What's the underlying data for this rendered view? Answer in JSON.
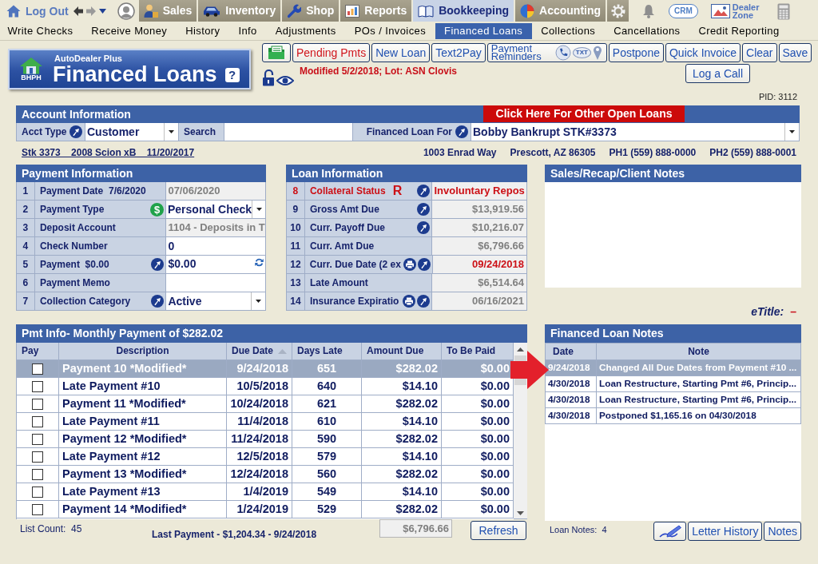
{
  "top_nav": {
    "logout": "Log Out",
    "tabs": [
      {
        "label": "Sales",
        "selected": false
      },
      {
        "label": "Inventory",
        "selected": false
      },
      {
        "label": "Shop",
        "selected": false
      },
      {
        "label": "Reports",
        "selected": false
      },
      {
        "label": "Bookkeeping",
        "selected": true
      },
      {
        "label": "Accounting",
        "selected": false
      }
    ],
    "crm": "CRM",
    "dealer_zone": "Dealer Zone"
  },
  "sub_nav": [
    {
      "label": "Write Checks",
      "selected": false
    },
    {
      "label": "Receive Money",
      "selected": false
    },
    {
      "label": "History",
      "selected": false
    },
    {
      "label": "Info",
      "selected": false
    },
    {
      "label": "Adjustments",
      "selected": false
    },
    {
      "label": "POs / Invoices",
      "selected": false
    },
    {
      "label": "Financed Loans",
      "selected": true
    },
    {
      "label": "Collections",
      "selected": false
    },
    {
      "label": "Cancellations",
      "selected": false
    },
    {
      "label": "Credit Reporting",
      "selected": false
    }
  ],
  "header": {
    "badge": "BHPH",
    "brand": "AutoDealer Plus",
    "title": "Financed Loans",
    "help": "?"
  },
  "toolbar": [
    {
      "kind": "icon"
    },
    {
      "kind": "alert",
      "label": "Pending Pmts"
    },
    {
      "kind": "plain",
      "label": "New Loan"
    },
    {
      "kind": "plain",
      "label": "Text2Pay"
    },
    {
      "kind": "reminders",
      "label": "Payment Reminders",
      "sms": "TXT"
    },
    {
      "kind": "plain",
      "label": "Postpone"
    },
    {
      "kind": "plain",
      "label": "Quick Invoice"
    },
    {
      "kind": "plain",
      "label": "Clear"
    },
    {
      "kind": "plain",
      "label": "Save"
    }
  ],
  "status": {
    "locked": false,
    "text": "Modified 5/2/2018; Lot: ASN Clovis",
    "call_button": "Log a Call",
    "pid": "PID: 3112"
  },
  "account": {
    "title": "Account Information",
    "other_loans": "Click Here For Other Open Loans",
    "acct_type": {
      "label": "Acct Type",
      "value": "Customer"
    },
    "search": {
      "label": "Search"
    },
    "loan_for": {
      "label": "Financed Loan For",
      "value": "Bobby Bankrupt STK#3373"
    }
  },
  "vehicle": {
    "link": "Stk 3373    2008 Scion xB    11/20/2017",
    "contact": [
      "1003 Enrad Way",
      "Prescott, AZ 86305",
      "PH1 (559) 888-0000",
      "PH2 (559) 888-0001"
    ]
  },
  "payment_info": {
    "title": "Payment Information",
    "rows": [
      {
        "num": "1",
        "label": "Payment Date  7/6/2020",
        "lookup": false,
        "kind": "readonly",
        "value": "07/06/2020"
      },
      {
        "num": "2",
        "label": "Payment Type",
        "symbol": "$",
        "lookup": false,
        "kind": "select",
        "value": "Personal Check"
      },
      {
        "num": "3",
        "label": "Deposit Account",
        "lookup": false,
        "kind": "readonly",
        "value": "1104 - Deposits in T"
      },
      {
        "num": "4",
        "label": "Check Number",
        "lookup": false,
        "kind": "input",
        "value": "0"
      },
      {
        "num": "5",
        "label": "Payment  $0.00",
        "lookup": true,
        "kind": "amount",
        "value": "$0.00"
      },
      {
        "num": "6",
        "label": "Payment Memo",
        "lookup": false,
        "kind": "input"
      },
      {
        "num": "7",
        "label": "Collection Category",
        "lookup": true,
        "kind": "select",
        "value": "Active"
      }
    ]
  },
  "loan_info": {
    "title": "Loan Information",
    "rows": [
      {
        "num": "8",
        "label": "Collateral Status",
        "flag": "R",
        "print": false,
        "lookup": true,
        "kind": "text",
        "alert": true,
        "value_alert": true,
        "value": "Involuntary Repos"
      },
      {
        "num": "9",
        "label": "Gross Amt Due",
        "print": false,
        "lookup": true,
        "kind": "amount",
        "alert": false,
        "value_alert": false,
        "value": "$13,919.56"
      },
      {
        "num": "10",
        "label": "Curr. Payoff Due",
        "print": false,
        "lookup": true,
        "kind": "amount",
        "alert": false,
        "value_alert": false,
        "value": "$10,216.07"
      },
      {
        "num": "11",
        "label": "Curr. Amt Due",
        "print": false,
        "lookup": false,
        "kind": "amount",
        "alert": false,
        "value_alert": false,
        "value": "$6,796.66"
      },
      {
        "num": "12",
        "label": "Curr. Due Date (2 ex",
        "print": true,
        "lookup": true,
        "kind": "amount",
        "alert": false,
        "value_alert": true,
        "value": "09/24/2018"
      },
      {
        "num": "13",
        "label": "Late Amount",
        "print": false,
        "lookup": false,
        "kind": "amount",
        "alert": false,
        "value_alert": false,
        "value": "$6,514.64"
      },
      {
        "num": "14",
        "label": "Insurance Expiratio",
        "print": true,
        "lookup": true,
        "kind": "amount",
        "alert": false,
        "value_alert": false,
        "value": "06/16/2021"
      }
    ]
  },
  "sales_notes": {
    "title": "Sales/Recap/Client Notes"
  },
  "etitle": {
    "label": "eTitle:",
    "value": "–"
  },
  "payments": {
    "title": "Pmt Info- Monthly Payment of $282.02",
    "columns": [
      {
        "label": "Pay",
        "sorted": false
      },
      {
        "label": "Description",
        "sorted": false
      },
      {
        "label": "Due Date",
        "sorted": true
      },
      {
        "label": "Days Late",
        "sorted": false
      },
      {
        "label": "Amount Due",
        "sorted": false
      },
      {
        "label": "To Be Paid",
        "sorted": false
      }
    ],
    "rows": [
      {
        "selected": true,
        "checked": false,
        "description": "Payment 10 *Modified*",
        "due_date": "9/24/2018",
        "days_late": "651",
        "amount_due": "$282.02",
        "to_be_paid": "$0.00"
      },
      {
        "selected": false,
        "checked": false,
        "description": "Late Payment #10",
        "due_date": "10/5/2018",
        "days_late": "640",
        "amount_due": "$14.10",
        "to_be_paid": "$0.00"
      },
      {
        "selected": false,
        "checked": false,
        "description": "Payment 11 *Modified*",
        "due_date": "10/24/2018",
        "days_late": "621",
        "amount_due": "$282.02",
        "to_be_paid": "$0.00"
      },
      {
        "selected": false,
        "checked": false,
        "description": "Late Payment #11",
        "due_date": "11/4/2018",
        "days_late": "610",
        "amount_due": "$14.10",
        "to_be_paid": "$0.00"
      },
      {
        "selected": false,
        "checked": false,
        "description": "Payment 12 *Modified*",
        "due_date": "11/24/2018",
        "days_late": "590",
        "amount_due": "$282.02",
        "to_be_paid": "$0.00"
      },
      {
        "selected": false,
        "checked": false,
        "description": "Late Payment #12",
        "due_date": "12/5/2018",
        "days_late": "579",
        "amount_due": "$14.10",
        "to_be_paid": "$0.00"
      },
      {
        "selected": false,
        "checked": false,
        "description": "Payment 13 *Modified*",
        "due_date": "12/24/2018",
        "days_late": "560",
        "amount_due": "$282.02",
        "to_be_paid": "$0.00"
      },
      {
        "selected": false,
        "checked": false,
        "description": "Late Payment #13",
        "due_date": "1/4/2019",
        "days_late": "549",
        "amount_due": "$14.10",
        "to_be_paid": "$0.00"
      },
      {
        "selected": false,
        "checked": false,
        "description": "Payment 14 *Modified*",
        "due_date": "1/24/2019",
        "days_late": "529",
        "amount_due": "$282.02",
        "to_be_paid": "$0.00"
      }
    ],
    "list_count": "List Count:  45",
    "last_payment": "Last Payment - $1,204.34 - 9/24/2018",
    "total": "$6,796.66",
    "refresh": "Refresh"
  },
  "loan_notes": {
    "title": "Financed Loan Notes",
    "columns": [
      "Date",
      "Note"
    ],
    "rows": [
      {
        "selected": true,
        "date": "9/24/2018",
        "note": "Changed All Due Dates from Payment #10 ..."
      },
      {
        "selected": false,
        "date": "4/30/2018",
        "note": "Loan Restructure, Starting Pmt #6, Princip..."
      },
      {
        "selected": false,
        "date": "4/30/2018",
        "note": "Loan Restructure, Starting Pmt #6, Princip..."
      },
      {
        "selected": false,
        "date": "4/30/2018",
        "note": "Postponed $1,165.16 on 04/30/2018"
      }
    ],
    "count": "Loan Notes:  4",
    "buttons": [
      {
        "kind": "icon"
      },
      {
        "kind": "plain",
        "label": "Letter History"
      },
      {
        "kind": "plain",
        "label": "Notes"
      }
    ]
  }
}
